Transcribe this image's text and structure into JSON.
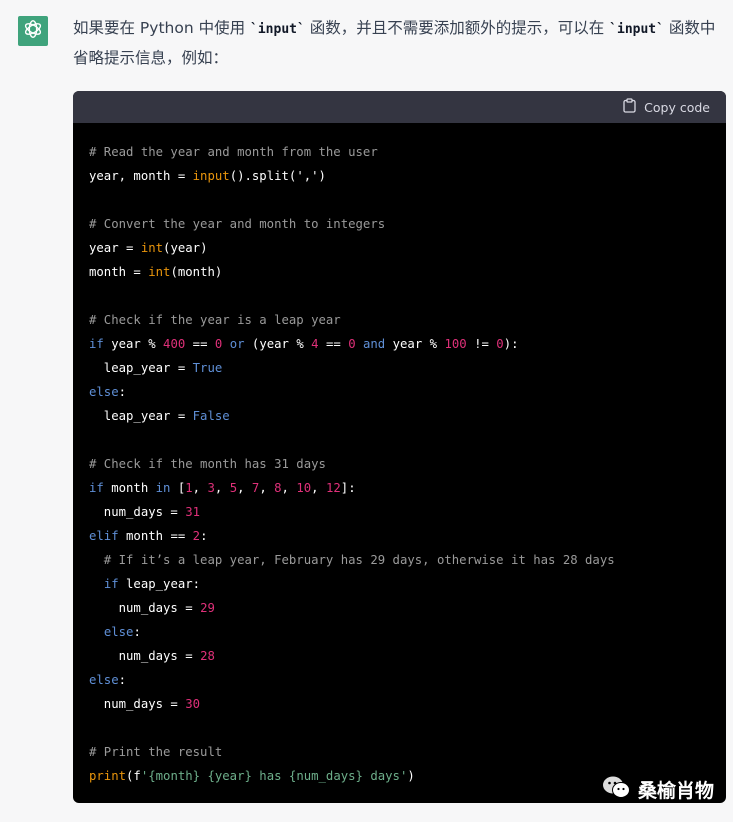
{
  "message": {
    "avatar_icon": "openai-logo-icon",
    "text_part1": "如果要在 Python 中使用 ",
    "code1": "`input`",
    "text_part2": " 函数，并且不需要添加额外的提示，可以在 ",
    "code2": "`input`",
    "text_part3": " 函数中省略提示信息，例如："
  },
  "code_block": {
    "copy_icon": "clipboard-icon",
    "copy_label": "Copy code",
    "lines": [
      [
        {
          "t": "cm",
          "v": "# Read the year and month from the user"
        }
      ],
      [
        {
          "t": "",
          "v": "year, month = "
        },
        {
          "t": "fn",
          "v": "input"
        },
        {
          "t": "",
          "v": "().split(','"
        },
        {
          "t": "",
          "v": ")"
        }
      ],
      [],
      [
        {
          "t": "cm",
          "v": "# Convert the year and month to integers"
        }
      ],
      [
        {
          "t": "",
          "v": "year = "
        },
        {
          "t": "fn",
          "v": "int"
        },
        {
          "t": "",
          "v": "(year)"
        }
      ],
      [
        {
          "t": "",
          "v": "month = "
        },
        {
          "t": "fn",
          "v": "int"
        },
        {
          "t": "",
          "v": "(month)"
        }
      ],
      [],
      [
        {
          "t": "cm",
          "v": "# Check if the year is a leap year"
        }
      ],
      [
        {
          "t": "kw",
          "v": "if"
        },
        {
          "t": "",
          "v": " year % "
        },
        {
          "t": "nm",
          "v": "400"
        },
        {
          "t": "",
          "v": " == "
        },
        {
          "t": "nm",
          "v": "0"
        },
        {
          "t": "",
          "v": " "
        },
        {
          "t": "kw",
          "v": "or"
        },
        {
          "t": "",
          "v": " (year % "
        },
        {
          "t": "nm",
          "v": "4"
        },
        {
          "t": "",
          "v": " == "
        },
        {
          "t": "nm",
          "v": "0"
        },
        {
          "t": "",
          "v": " "
        },
        {
          "t": "kw",
          "v": "and"
        },
        {
          "t": "",
          "v": " year % "
        },
        {
          "t": "nm",
          "v": "100"
        },
        {
          "t": "",
          "v": " != "
        },
        {
          "t": "nm",
          "v": "0"
        },
        {
          "t": "",
          "v": "):"
        }
      ],
      [
        {
          "t": "",
          "v": "  leap_year = "
        },
        {
          "t": "kw",
          "v": "True"
        }
      ],
      [
        {
          "t": "kw",
          "v": "else"
        },
        {
          "t": "",
          "v": ":"
        }
      ],
      [
        {
          "t": "",
          "v": "  leap_year = "
        },
        {
          "t": "kw",
          "v": "False"
        }
      ],
      [],
      [
        {
          "t": "cm",
          "v": "# Check if the month has 31 days"
        }
      ],
      [
        {
          "t": "kw",
          "v": "if"
        },
        {
          "t": "",
          "v": " month "
        },
        {
          "t": "kw",
          "v": "in"
        },
        {
          "t": "",
          "v": " ["
        },
        {
          "t": "nm",
          "v": "1"
        },
        {
          "t": "",
          "v": ", "
        },
        {
          "t": "nm",
          "v": "3"
        },
        {
          "t": "",
          "v": ", "
        },
        {
          "t": "nm",
          "v": "5"
        },
        {
          "t": "",
          "v": ", "
        },
        {
          "t": "nm",
          "v": "7"
        },
        {
          "t": "",
          "v": ", "
        },
        {
          "t": "nm",
          "v": "8"
        },
        {
          "t": "",
          "v": ", "
        },
        {
          "t": "nm",
          "v": "10"
        },
        {
          "t": "",
          "v": ", "
        },
        {
          "t": "nm",
          "v": "12"
        },
        {
          "t": "",
          "v": "]:"
        }
      ],
      [
        {
          "t": "",
          "v": "  num_days = "
        },
        {
          "t": "nm",
          "v": "31"
        }
      ],
      [
        {
          "t": "kw",
          "v": "elif"
        },
        {
          "t": "",
          "v": " month == "
        },
        {
          "t": "nm",
          "v": "2"
        },
        {
          "t": "",
          "v": ":"
        }
      ],
      [
        {
          "t": "cm",
          "v": "  # If it’s a leap year, February has 29 days, otherwise it has 28 days"
        }
      ],
      [
        {
          "t": "",
          "v": "  "
        },
        {
          "t": "kw",
          "v": "if"
        },
        {
          "t": "",
          "v": " leap_year:"
        }
      ],
      [
        {
          "t": "",
          "v": "    num_days = "
        },
        {
          "t": "nm",
          "v": "29"
        }
      ],
      [
        {
          "t": "",
          "v": "  "
        },
        {
          "t": "kw",
          "v": "else"
        },
        {
          "t": "",
          "v": ":"
        }
      ],
      [
        {
          "t": "",
          "v": "    num_days = "
        },
        {
          "t": "nm",
          "v": "28"
        }
      ],
      [
        {
          "t": "kw",
          "v": "else"
        },
        {
          "t": "",
          "v": ":"
        }
      ],
      [
        {
          "t": "",
          "v": "  num_days = "
        },
        {
          "t": "nm",
          "v": "30"
        }
      ],
      [],
      [
        {
          "t": "cm",
          "v": "# Print the result"
        }
      ],
      [
        {
          "t": "fn",
          "v": "print"
        },
        {
          "t": "",
          "v": "(f"
        },
        {
          "t": "st",
          "v": "'{month} {year} has {num_days} days'"
        },
        {
          "t": "",
          "v": ")"
        }
      ]
    ]
  },
  "watermark": {
    "icon": "wechat-icon",
    "label": "桑榆肖物"
  },
  "colors": {
    "accent": "#3fa37c",
    "comment": "#9a9a9a",
    "keyword": "#5f8fd6",
    "function": "#e9950c",
    "number": "#df3079",
    "string": "#6dae8a"
  }
}
